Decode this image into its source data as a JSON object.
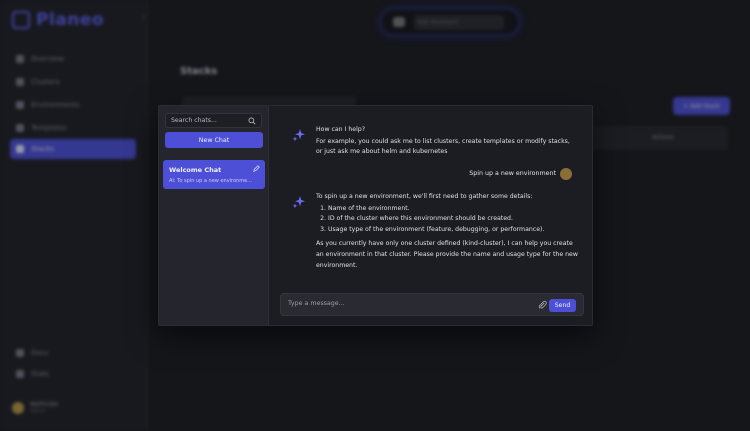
{
  "app": {
    "name": "Planeo"
  },
  "sidebar": {
    "items": [
      {
        "label": "Overview"
      },
      {
        "label": "Clusters"
      },
      {
        "label": "Environments"
      },
      {
        "label": "Templates"
      },
      {
        "label": "Stacks"
      }
    ],
    "bottom_items": [
      {
        "label": "Docs"
      },
      {
        "label": "Stats"
      }
    ],
    "user": {
      "name": "NetFinder",
      "role": "Admin"
    }
  },
  "topbar": {
    "search_placeholder": "Ask Assistant"
  },
  "page": {
    "title": "Stacks",
    "add_button": "+ Add Stack",
    "actions_header": "Actions"
  },
  "chat": {
    "search_placeholder": "Search chats...",
    "new_chat_label": "New Chat",
    "conversations": [
      {
        "title": "Welcome Chat",
        "preview": "AI: To spin up a new environme..."
      }
    ],
    "messages": {
      "assistant_1_title": "How can I help?",
      "assistant_1_body": "For example, you could ask me to list clusters, create templates or modify stacks, or just ask me about helm and kubernetes",
      "user_1": "Spin up a new environment",
      "assistant_2_intro": "To spin up a new environment, we'll first need to gather some details:",
      "assistant_2_list": [
        "Name of the environment.",
        "ID of the cluster where this environment should be created.",
        "Usage type of the environment (feature, debugging, or performance)."
      ],
      "assistant_2_outro": "As you currently have only one cluster defined (kind-cluster), I can help you create an environment in that cluster. Please provide the name and usage type for the new environment."
    },
    "composer": {
      "placeholder": "Type a message...",
      "send_label": "Send"
    }
  }
}
